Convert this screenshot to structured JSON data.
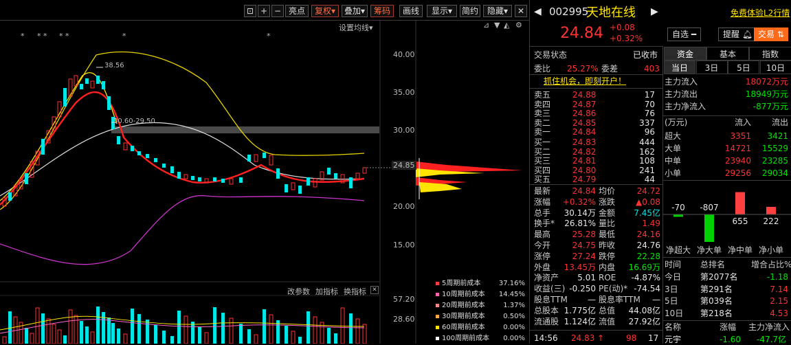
{
  "toolbar": {
    "buttons": [
      "亮点",
      "复权",
      "叠加",
      "筹码",
      "画线",
      "显示",
      "简约",
      "隐藏"
    ],
    "icons": [
      "+",
      "−"
    ]
  },
  "chart": {
    "ma_setting": "设置均线",
    "stars": [
      "*",
      "* *",
      "* *",
      "*",
      "*"
    ],
    "high_label": "38.56",
    "range_label": "30.60-29.50",
    "current_price_tag": "24.85",
    "y_ticks": [
      "40.00",
      "35.00",
      "30.00",
      "25.00",
      "20.00",
      "15.00"
    ],
    "vol_ticks": [
      "57.20",
      "28.60"
    ],
    "indicator_btns": [
      "改参数",
      "加指标",
      "换指标"
    ],
    "cost_legend": [
      {
        "label": "5周期前成本",
        "value": "37.16%",
        "color": "#ff3b3b"
      },
      {
        "label": "10周期前成本",
        "value": "14.45%",
        "color": "#ff66aa"
      },
      {
        "label": "20周期前成本",
        "value": "1.37%",
        "color": "#ff8888"
      },
      {
        "label": "30周期前成本",
        "value": "0.50%",
        "color": "#ffaa44"
      },
      {
        "label": "60周期前成本",
        "value": "0.00%",
        "color": "#ffe400"
      },
      {
        "label": "100周期前成本",
        "value": "0.00%",
        "color": "#ffffff"
      }
    ]
  },
  "header": {
    "code": "002995",
    "name": "天地在线",
    "l2_link": "免费体验L2行情",
    "price": "24.84",
    "change": "+0.08",
    "change_pct": "+0.32%",
    "btn_watch": "自选",
    "btn_alert": "提醒",
    "btn_trade": "交易"
  },
  "status": {
    "label": "交易状态",
    "value": "已收市"
  },
  "ratio": {
    "label1": "委比",
    "value1": "25.27%",
    "label2": "委差",
    "value2": "403"
  },
  "banner": "抓住机会，即刻开户！",
  "asks": [
    {
      "label": "卖五",
      "price": "24.88",
      "vol": "17"
    },
    {
      "label": "卖四",
      "price": "24.87",
      "vol": "70"
    },
    {
      "label": "卖三",
      "price": "24.86",
      "vol": "76"
    },
    {
      "label": "卖二",
      "price": "24.85",
      "vol": "337"
    },
    {
      "label": "卖一",
      "price": "24.84",
      "vol": "96"
    }
  ],
  "bids": [
    {
      "label": "买一",
      "price": "24.83",
      "vol": "444"
    },
    {
      "label": "买二",
      "price": "24.82",
      "vol": "162"
    },
    {
      "label": "买三",
      "price": "24.81",
      "vol": "108"
    },
    {
      "label": "买四",
      "price": "24.80",
      "vol": "241"
    },
    {
      "label": "买五",
      "price": "24.79",
      "vol": "44"
    }
  ],
  "stats": [
    {
      "l1": "最新",
      "v1": "24.84",
      "c1": "red",
      "l2": "均价",
      "v2": "24.72",
      "c2": "red"
    },
    {
      "l1": "涨幅",
      "v1": "+0.32%",
      "c1": "red",
      "l2": "涨跌",
      "v2": "▲0.08",
      "c2": "red"
    },
    {
      "l1": "总手",
      "v1": "30.14万",
      "c1": "white",
      "l2": "金额",
      "v2": "7.45亿",
      "c2": "cyan"
    },
    {
      "l1": "换手*",
      "v1": "26.81%",
      "c1": "white",
      "l2": "量比",
      "v2": "1.49",
      "c2": "red"
    },
    {
      "l1": "最高",
      "v1": "25.28",
      "c1": "red",
      "l2": "最低",
      "v2": "24.16",
      "c2": "red"
    },
    {
      "l1": "今开",
      "v1": "24.75",
      "c1": "red",
      "l2": "昨收",
      "v2": "24.76",
      "c2": "white"
    },
    {
      "l1": "涨停",
      "v1": "27.24",
      "c1": "red",
      "l2": "跌停",
      "v2": "22.28",
      "c2": "green"
    },
    {
      "l1": "外盘",
      "v1": "13.45万",
      "c1": "red",
      "l2": "内盘",
      "v2": "16.69万",
      "c2": "green"
    },
    {
      "l1": "净资产",
      "v1": "5.01",
      "c1": "white",
      "l2": "ROE",
      "v2": "-4.87%",
      "c2": "white"
    },
    {
      "l1": "收益(三)",
      "v1": "-0.250",
      "c1": "white",
      "l2": "PE(动)*",
      "v2": "-74.54",
      "c2": "white"
    },
    {
      "l1": "股息TTM",
      "v1": "—",
      "c1": "white",
      "l2": "股息率TTM",
      "v2": "—",
      "c2": "white"
    },
    {
      "l1": "总股本",
      "v1": "1.775亿",
      "c1": "white",
      "l2": "总值",
      "v2": "44.08亿",
      "c2": "white"
    },
    {
      "l1": "流通股",
      "v1": "1.124亿",
      "c1": "white",
      "l2": "流值",
      "v2": "27.92亿",
      "c2": "white"
    }
  ],
  "last_trade": {
    "time": "14:56",
    "price": "24.83",
    "arrow": "↑",
    "vol": "98",
    "count": "17"
  },
  "fund": {
    "tabs": [
      "资金",
      "基本",
      "指数"
    ],
    "periods": [
      "当日",
      "3日",
      "5日",
      "10日"
    ],
    "main": [
      {
        "label": "主力流入",
        "value": "18072万元",
        "color": "red"
      },
      {
        "label": "主力流出",
        "value": "18949万元",
        "color": "green"
      },
      {
        "label": "主力净流入",
        "value": "-877万元",
        "color": "green"
      }
    ],
    "table_head": [
      "(万元)",
      "流入",
      "流出"
    ],
    "table": [
      {
        "label": "超大",
        "in": "3351",
        "out": "3421"
      },
      {
        "label": "大单",
        "in": "14721",
        "out": "15529"
      },
      {
        "label": "中单",
        "in": "23940",
        "out": "23285"
      },
      {
        "label": "小单",
        "in": "29256",
        "out": "29034"
      }
    ],
    "bars": [
      {
        "label": "净超大",
        "value": -70
      },
      {
        "label": "净大单",
        "value": -807
      },
      {
        "label": "净中单",
        "value": 655
      },
      {
        "label": "净小单",
        "value": 222
      }
    ],
    "rank_head": [
      "时间",
      "总排名",
      "增合占比%"
    ],
    "rank": [
      {
        "t": "今日",
        "r": "第2077名",
        "p": "-1.18",
        "c": "green"
      },
      {
        "t": "3日",
        "r": "第291名",
        "p": "7.14",
        "c": "red"
      },
      {
        "t": "5日",
        "r": "第039名",
        "p": "2.15",
        "c": "red"
      },
      {
        "t": "10日",
        "r": "第218名",
        "p": "4.53",
        "c": "red"
      }
    ],
    "sector_head": [
      "名称",
      "涨幅",
      "主力净流入"
    ],
    "sector": {
      "name": "元宇",
      "pct": "-1.60",
      "flow": "-47.7亿"
    }
  }
}
